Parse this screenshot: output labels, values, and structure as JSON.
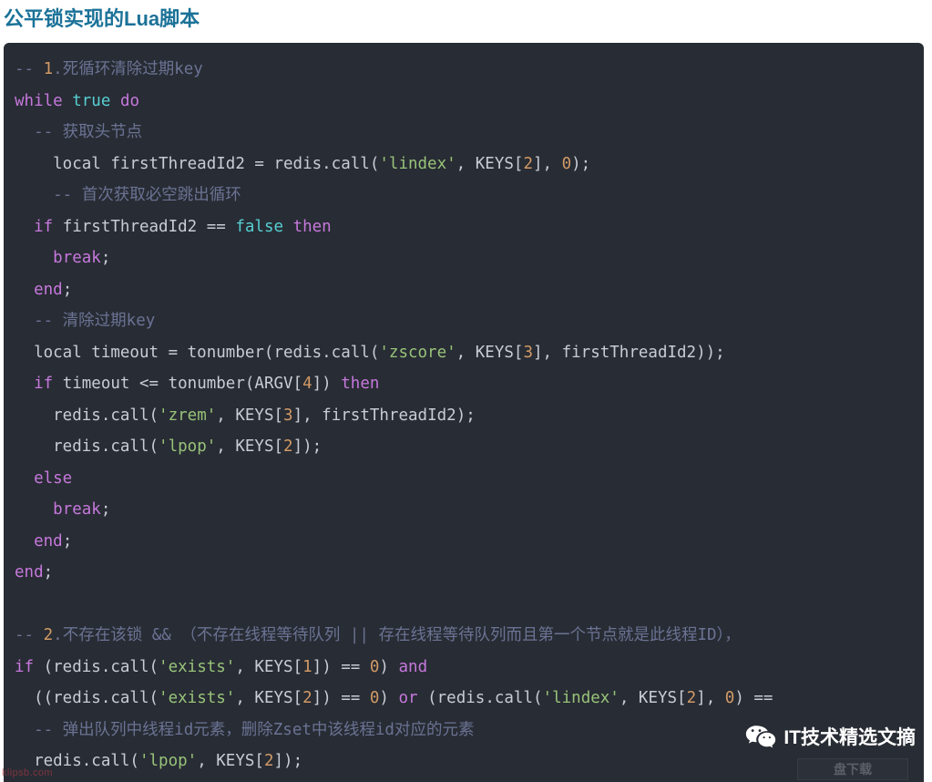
{
  "title": "公平锁实现的Lua脚本",
  "code": {
    "language": "lua",
    "lines": [
      [
        {
          "t": "cmt",
          "v": "-- "
        },
        {
          "t": "num",
          "v": "1"
        },
        {
          "t": "cmt",
          "v": ".死循环清除过期key"
        }
      ],
      [
        {
          "t": "kw",
          "v": "while"
        },
        {
          "t": "pln",
          "v": " "
        },
        {
          "t": "bool",
          "v": "true"
        },
        {
          "t": "pln",
          "v": " "
        },
        {
          "t": "kw",
          "v": "do"
        }
      ],
      [
        {
          "t": "cmt",
          "v": "  -- 获取头节点"
        }
      ],
      [
        {
          "t": "pln",
          "v": "    local firstThreadId2 = redis.call("
        },
        {
          "t": "str",
          "v": "'lindex'"
        },
        {
          "t": "pln",
          "v": ", KEYS["
        },
        {
          "t": "num",
          "v": "2"
        },
        {
          "t": "pln",
          "v": "], "
        },
        {
          "t": "num",
          "v": "0"
        },
        {
          "t": "pln",
          "v": ");"
        }
      ],
      [
        {
          "t": "cmt",
          "v": "    -- 首次获取必空跳出循环"
        }
      ],
      [
        {
          "t": "pln",
          "v": "  "
        },
        {
          "t": "kw",
          "v": "if"
        },
        {
          "t": "pln",
          "v": " firstThreadId2 == "
        },
        {
          "t": "bool",
          "v": "false"
        },
        {
          "t": "pln",
          "v": " "
        },
        {
          "t": "kw",
          "v": "then"
        }
      ],
      [
        {
          "t": "pln",
          "v": "    "
        },
        {
          "t": "kw",
          "v": "break"
        },
        {
          "t": "pln",
          "v": ";"
        }
      ],
      [
        {
          "t": "pln",
          "v": "  "
        },
        {
          "t": "kw",
          "v": "end"
        },
        {
          "t": "pln",
          "v": ";"
        }
      ],
      [
        {
          "t": "cmt",
          "v": "  -- 清除过期key"
        }
      ],
      [
        {
          "t": "pln",
          "v": "  local timeout = tonumber(redis.call("
        },
        {
          "t": "str",
          "v": "'zscore'"
        },
        {
          "t": "pln",
          "v": ", KEYS["
        },
        {
          "t": "num",
          "v": "3"
        },
        {
          "t": "pln",
          "v": "], firstThreadId2));"
        }
      ],
      [
        {
          "t": "pln",
          "v": "  "
        },
        {
          "t": "kw",
          "v": "if"
        },
        {
          "t": "pln",
          "v": " timeout <= tonumber(ARGV["
        },
        {
          "t": "num",
          "v": "4"
        },
        {
          "t": "pln",
          "v": "]) "
        },
        {
          "t": "kw",
          "v": "then"
        }
      ],
      [
        {
          "t": "pln",
          "v": "    redis.call("
        },
        {
          "t": "str",
          "v": "'zrem'"
        },
        {
          "t": "pln",
          "v": ", KEYS["
        },
        {
          "t": "num",
          "v": "3"
        },
        {
          "t": "pln",
          "v": "], firstThreadId2);"
        }
      ],
      [
        {
          "t": "pln",
          "v": "    redis.call("
        },
        {
          "t": "str",
          "v": "'lpop'"
        },
        {
          "t": "pln",
          "v": ", KEYS["
        },
        {
          "t": "num",
          "v": "2"
        },
        {
          "t": "pln",
          "v": "]);"
        }
      ],
      [
        {
          "t": "pln",
          "v": "  "
        },
        {
          "t": "kw",
          "v": "else"
        }
      ],
      [
        {
          "t": "pln",
          "v": "    "
        },
        {
          "t": "kw",
          "v": "break"
        },
        {
          "t": "pln",
          "v": ";"
        }
      ],
      [
        {
          "t": "pln",
          "v": "  "
        },
        {
          "t": "kw",
          "v": "end"
        },
        {
          "t": "pln",
          "v": ";"
        }
      ],
      [
        {
          "t": "kw",
          "v": "end"
        },
        {
          "t": "pln",
          "v": ";"
        }
      ],
      [],
      [
        {
          "t": "cmt",
          "v": "-- "
        },
        {
          "t": "num",
          "v": "2"
        },
        {
          "t": "cmt",
          "v": ".不存在该锁 && （不存在线程等待队列 || 存在线程等待队列而且第一个节点就是此线程ID），"
        }
      ],
      [
        {
          "t": "kw",
          "v": "if"
        },
        {
          "t": "pln",
          "v": " (redis.call("
        },
        {
          "t": "str",
          "v": "'exists'"
        },
        {
          "t": "pln",
          "v": ", KEYS["
        },
        {
          "t": "num",
          "v": "1"
        },
        {
          "t": "pln",
          "v": "]) == "
        },
        {
          "t": "num",
          "v": "0"
        },
        {
          "t": "pln",
          "v": ") "
        },
        {
          "t": "kw",
          "v": "and"
        }
      ],
      [
        {
          "t": "pln",
          "v": "  ((redis.call("
        },
        {
          "t": "str",
          "v": "'exists'"
        },
        {
          "t": "pln",
          "v": ", KEYS["
        },
        {
          "t": "num",
          "v": "2"
        },
        {
          "t": "pln",
          "v": "]) == "
        },
        {
          "t": "num",
          "v": "0"
        },
        {
          "t": "pln",
          "v": ") "
        },
        {
          "t": "kw",
          "v": "or"
        },
        {
          "t": "pln",
          "v": " (redis.call("
        },
        {
          "t": "str",
          "v": "'lindex'"
        },
        {
          "t": "pln",
          "v": ", KEYS["
        },
        {
          "t": "num",
          "v": "2"
        },
        {
          "t": "pln",
          "v": "], "
        },
        {
          "t": "num",
          "v": "0"
        },
        {
          "t": "pln",
          "v": ") =="
        }
      ],
      [
        {
          "t": "cmt",
          "v": "  -- 弹出队列中线程id元素，删除Zset中该线程id对应的元素"
        }
      ],
      [
        {
          "t": "pln",
          "v": "  redis.call("
        },
        {
          "t": "str",
          "v": "'lpop'"
        },
        {
          "t": "pln",
          "v": ", KEYS["
        },
        {
          "t": "num",
          "v": "2"
        },
        {
          "t": "pln",
          "v": "]);"
        }
      ]
    ]
  },
  "watermarks": {
    "wechat_account": "IT技术精选文摘",
    "wechat_icon": "wechat-logo-icon",
    "corner_label": "盘下载",
    "url": "klipsb.com"
  },
  "colors": {
    "title": "#1b7298",
    "code_background": "#282c34",
    "comment": "#6b7394",
    "keyword": "#c678dd",
    "boolean": "#56cfd2",
    "string": "#98c379",
    "number": "#d19a66",
    "plain": "#c8ccd4",
    "page_background": "#ffffff"
  }
}
